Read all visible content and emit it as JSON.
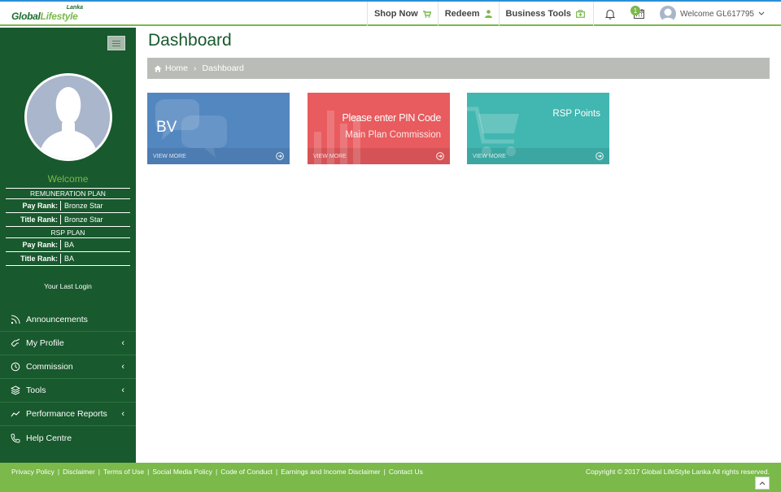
{
  "header": {
    "logo_small": "Lanka",
    "logo_main_1": "Global",
    "logo_main_2": "Lifestyle",
    "nav": [
      {
        "label": "Shop Now",
        "icon": "cart-icon"
      },
      {
        "label": "Redeem",
        "icon": "user-icon"
      },
      {
        "label": "Business Tools",
        "icon": "briefcase-icon"
      }
    ],
    "notification_count": "1",
    "user_greeting": "Welcome GL617795"
  },
  "sidebar": {
    "welcome": "Welcome",
    "remuneration_plan": "REMUNERATION PLAN",
    "rem_pay_rank_label": "Pay Rank:",
    "rem_pay_rank_value": "Bronze Star",
    "rem_title_rank_label": "Title Rank:",
    "rem_title_rank_value": "Bronze Star",
    "rsp_plan": "RSP PLAN",
    "rsp_pay_rank_label": "Pay Rank:",
    "rsp_pay_rank_value": "BA",
    "rsp_title_rank_label": "Title Rank:",
    "rsp_title_rank_value": "BA",
    "last_login": "Your Last Login",
    "menu": [
      {
        "label": "Announcements",
        "icon": "rss-icon",
        "has_submenu": false
      },
      {
        "label": "My Profile",
        "icon": "hand-icon",
        "has_submenu": true
      },
      {
        "label": "Commission",
        "icon": "clock-icon",
        "has_submenu": true
      },
      {
        "label": "Tools",
        "icon": "layers-icon",
        "has_submenu": true
      },
      {
        "label": "Performance Reports",
        "icon": "trend-icon",
        "has_submenu": true
      },
      {
        "label": "Help Centre",
        "icon": "phone-icon",
        "has_submenu": false
      }
    ]
  },
  "main": {
    "title": "Dashboard",
    "breadcrumb": [
      "Home",
      "Dashboard"
    ],
    "tiles": [
      {
        "title": "BV",
        "subtitle": "",
        "footer": "VIEW MORE",
        "color": "#5387c0"
      },
      {
        "title": "Please enter PIN Code",
        "subtitle": "Main Plan Commission",
        "footer": "VIEW MORE",
        "color": "#e85b5e"
      },
      {
        "title": "RSP Points",
        "subtitle": "",
        "footer": "VIEW MORE",
        "color": "#42b6b0"
      }
    ]
  },
  "footer": {
    "links": [
      "Privacy Policy",
      "Disclaimer",
      "Terms of Use",
      "Social Media Policy",
      "Code of Conduct",
      "Earnings and Income Disclaimer",
      "Contact Us"
    ],
    "copyright": "Copyright © 2017 Global LifeStyle Lanka All rights reserved."
  },
  "colors": {
    "sidebar_bg": "#18592d",
    "accent_green": "#7ab94a",
    "breadcrumb_bg": "#babdb7"
  }
}
